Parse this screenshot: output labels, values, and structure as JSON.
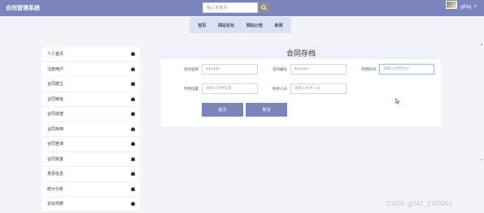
{
  "app": {
    "title": "合同管理系统"
  },
  "search": {
    "placeholder": "输入关键词"
  },
  "user": {
    "name": "gfdg"
  },
  "nav": {
    "items": [
      "首页",
      "网站论坛",
      "网站公告",
      "新闻"
    ]
  },
  "sidebar": {
    "items": [
      "个人首页",
      "注册用户",
      "合同建立",
      "合同审批",
      "合同进度",
      "合同存档",
      "合同查询",
      "合同资金",
      "发票信息",
      "统计分析",
      "论坛列表"
    ]
  },
  "form": {
    "title": "合同存档",
    "fields": {
      "contract_name": {
        "label": "合同名称",
        "value": "111111"
      },
      "contract_no": {
        "label": "合同编号",
        "value": "111111"
      },
      "archive_time": {
        "label": "存档时间",
        "placeholder": "请输入存档时间"
      },
      "archive_location": {
        "label": "存档位置",
        "placeholder": "请输入存档位置"
      },
      "handler": {
        "label": "经手人员",
        "placeholder": "请输入经手人员"
      }
    },
    "submit_label": "提交",
    "cancel_label": "取消"
  },
  "watermark": "CSDN @MZ_ZXD001",
  "colors": {
    "header": "#7b84bb",
    "nav_bg": "#dde0ee",
    "button": "#7b84bb",
    "page_bg": "#f3f4f8"
  }
}
